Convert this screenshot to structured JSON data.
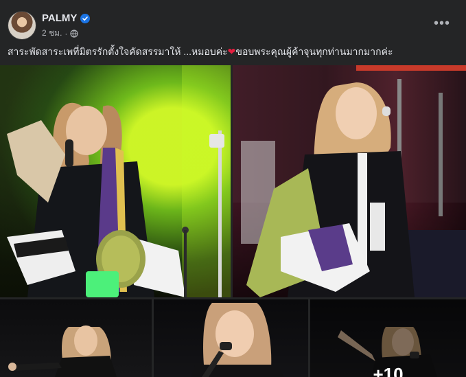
{
  "post": {
    "author": "PALMY",
    "time": "2 ชม.",
    "separator": "·",
    "more_label": "•••",
    "caption_before": "สาระพัดสาระเพที่มิตรรักตั้งใจคัดสรรมาให้ ...หมอบค่ะ",
    "caption_heart": "❤",
    "caption_after": "ขอบพระคุณผู้ค้าจุนทุกท่านมากมากค่ะ",
    "more_photos_label": "+10"
  },
  "icons": {
    "verified": "verified-badge-icon",
    "audience": "globe-icon",
    "more": "more-options-icon"
  },
  "colors": {
    "card_bg": "#242526",
    "page_bg": "#18191a",
    "text_primary": "#e4e6eb",
    "text_secondary": "#b0b3b8",
    "verified_blue": "#1b74e4",
    "heart_red": "#e41e3f"
  }
}
